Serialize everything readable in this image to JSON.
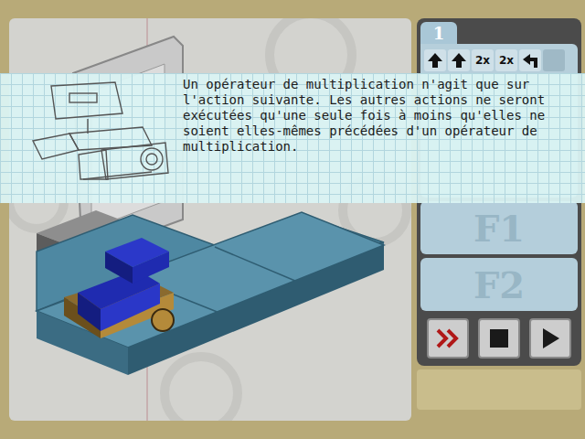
{
  "tooltip": {
    "text": "Un opérateur de multiplication n'agit que sur l'action suivante. Les autres actions ne seront exécutées qu'une seule fois à moins qu'elles ne soient elles-mêmes précédées d'un opérateur de multiplication."
  },
  "program": {
    "tab": {
      "label": "1",
      "selected": true
    },
    "slots": [
      {
        "kind": "forward"
      },
      {
        "kind": "forward"
      },
      {
        "kind": "multiply",
        "label": "2x"
      },
      {
        "kind": "multiply",
        "label": "2x"
      },
      {
        "kind": "turn-left"
      },
      {
        "kind": "empty"
      }
    ]
  },
  "functions": [
    {
      "label": "F1"
    },
    {
      "label": "F2"
    }
  ],
  "controls": [
    {
      "kind": "fast-forward",
      "active": true
    },
    {
      "kind": "stop",
      "active": false
    },
    {
      "kind": "play",
      "active": false
    }
  ]
}
